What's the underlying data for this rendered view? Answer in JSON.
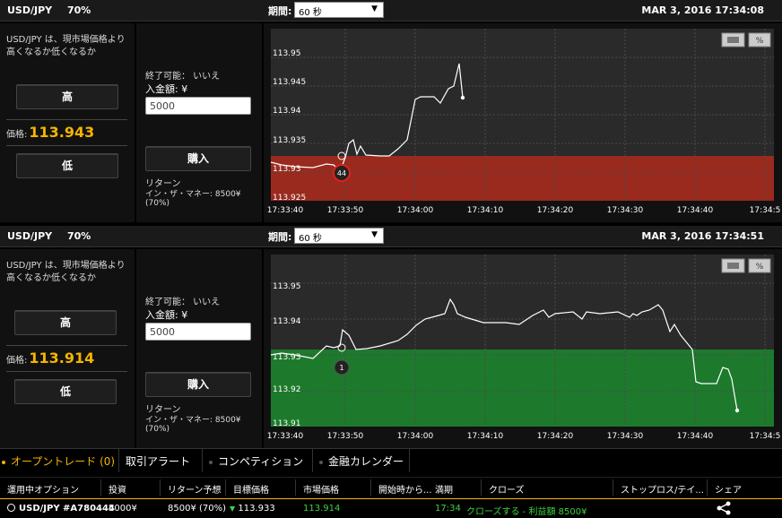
{
  "panel1": {
    "pair": "USD/JPY",
    "payout": "70%",
    "period_label": "期間:",
    "period_value": "60 秒",
    "date": "MAR 3, 2016 17:34:08",
    "question": "USD/JPY は、現市場価格より高くなるか低くなるか",
    "high_label": "高",
    "low_label": "低",
    "price_label": "価格:",
    "price_value": "113.943",
    "expire_label": "終了可能： いいえ",
    "deposit_label": "入金額: ¥",
    "amount": "5000",
    "buy_label": "購入",
    "return_label": "リターン",
    "itm_label": "イン・ザ・マネー: 8500¥ (70%)",
    "marker_label": "44",
    "chart": {
      "y_ticks": [
        "113.95",
        "113.945",
        "113.94",
        "113.935",
        "113.93",
        "113.925"
      ],
      "x_ticks": [
        "17:33:40",
        "17:33:50",
        "17:34:00",
        "17:34:10",
        "17:34:20",
        "17:34:30",
        "17:34:40",
        "17:34:5"
      ],
      "zone_color": "#9a2a1e"
    }
  },
  "panel2": {
    "pair": "USD/JPY",
    "payout": "70%",
    "period_label": "期間:",
    "period_value": "60 秒",
    "date": "MAR 3, 2016 17:34:51",
    "question": "USD/JPY は、現市場価格より高くなるか低くなるか",
    "high_label": "高",
    "low_label": "低",
    "price_label": "価格:",
    "price_value": "113.914",
    "expire_label": "終了可能： いいえ",
    "deposit_label": "入金額: ¥",
    "amount": "5000",
    "buy_label": "購入",
    "return_label": "リターン",
    "itm_label": "イン・ザ・マネー: 8500¥ (70%)",
    "marker_label": "1",
    "chart": {
      "y_ticks": [
        "113.95",
        "113.94",
        "113.93",
        "113.92",
        "113.91"
      ],
      "x_ticks": [
        "17:33:40",
        "17:33:50",
        "17:34:00",
        "17:34:10",
        "17:34:20",
        "17:34:30",
        "17:34:40",
        "17:34:5"
      ],
      "zone_color": "#1d7a2c"
    }
  },
  "tabs": [
    {
      "label": "オープントレード (0)"
    },
    {
      "label": "取引アラート"
    },
    {
      "label": "コンペティション"
    },
    {
      "label": "金融カレンダー"
    }
  ],
  "table": {
    "headers": [
      "運用中オプション",
      "投資",
      "リターン予想",
      "目標価格",
      "市場価格",
      "開始時から...",
      "満期",
      "クローズ",
      "ストップロス/テイ...",
      "シェア"
    ],
    "row": {
      "option": "USD/JPY #A780444",
      "invest": "5000¥",
      "expected": "8500¥ (70%)",
      "target": "113.933",
      "market": "113.914",
      "expiry": "17:34",
      "close": "クローズする - 利益額 8500¥"
    }
  },
  "colors": {
    "accent": "#f4b400",
    "profit_green": "#3ed13e",
    "put_zone": "#9a2a1e",
    "call_zone": "#1d7a2c"
  }
}
